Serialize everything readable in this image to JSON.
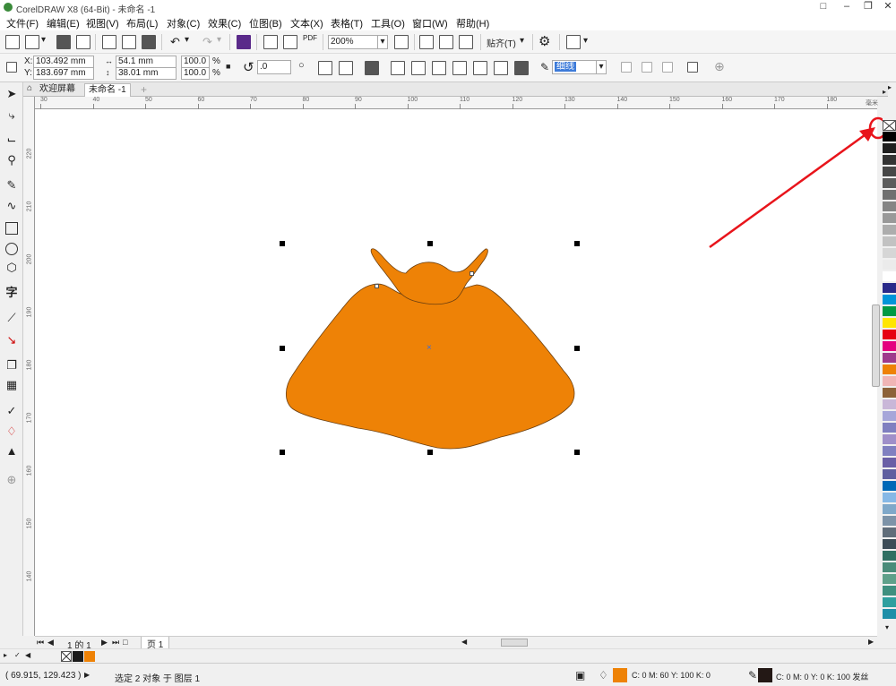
{
  "app": {
    "title": "CorelDRAW X8 (64-Bit) - 未命名 -1"
  },
  "menu": {
    "items": [
      "文件(F)",
      "编辑(E)",
      "视图(V)",
      "布局(L)",
      "对象(C)",
      "效果(C)",
      "位图(B)",
      "文本(X)",
      "表格(T)",
      "工具(O)",
      "窗口(W)",
      "帮助(H)"
    ]
  },
  "toolbar": {
    "zoom": "200%",
    "snap_label": "贴齐(T)",
    "pdf_label": "PDF"
  },
  "properties": {
    "x_label": "X:",
    "y_label": "Y:",
    "x_value": "103.492 mm",
    "y_value": "183.697 mm",
    "width_value": "54.1 mm",
    "height_value": "38.01 mm",
    "scale_x": "100.0",
    "scale_y": "100.0",
    "percent": "%",
    "rotation": ".0",
    "outline": "细线"
  },
  "tabs": {
    "welcome": "欢迎屏幕",
    "document": "未命名 -1"
  },
  "ruler": {
    "unit": "毫米",
    "h_ticks": [
      "30",
      "40",
      "50",
      "60",
      "70",
      "80",
      "90",
      "100",
      "110",
      "120",
      "130",
      "140",
      "150",
      "160",
      "170",
      "180"
    ],
    "v_ticks": [
      "220",
      "210",
      "200",
      "190",
      "180",
      "170",
      "160",
      "150",
      "140"
    ]
  },
  "pages": {
    "counter": "1 的 1",
    "page_tab": "页 1"
  },
  "status": {
    "coords": "( 69.915, 129.423 )",
    "selection": "选定 2 对象 于 图层 1",
    "fill_info": "C: 0 M: 60 Y: 100 K: 0",
    "outline_info": "C: 0 M: 0 Y: 0 K: 100  发丝"
  },
  "colors": {
    "fill": "#ee8206",
    "annotation": "#e8141b",
    "palette": [
      "#ffffff",
      "#000000",
      "#1f1f1f",
      "#333333",
      "#474747",
      "#5c5c5c",
      "#707070",
      "#858585",
      "#999999",
      "#adadad",
      "#c2c2c2",
      "#d6d6d6",
      "#ebebeb",
      "#ffffff",
      "#2a2a8a",
      "#0095d9",
      "#009944",
      "#ffe500",
      "#e60012",
      "#e4007f",
      "#9e3a8c",
      "#ee8206",
      "#f0b5b5",
      "#8c6239",
      "#c9b7d8",
      "#a6a6d9",
      "#7f7fc0",
      "#9f8fc9",
      "#8080c0",
      "#6a5fa6",
      "#5f5fa0",
      "#0068b7",
      "#86b8e6",
      "#7fa8c9",
      "#7d93a8",
      "#606d7a",
      "#3d4c57",
      "#2f6f62",
      "#4a8c7a",
      "#5fa08a",
      "#3f8f7f",
      "#2f9f9f",
      "#1f8fa8"
    ]
  }
}
